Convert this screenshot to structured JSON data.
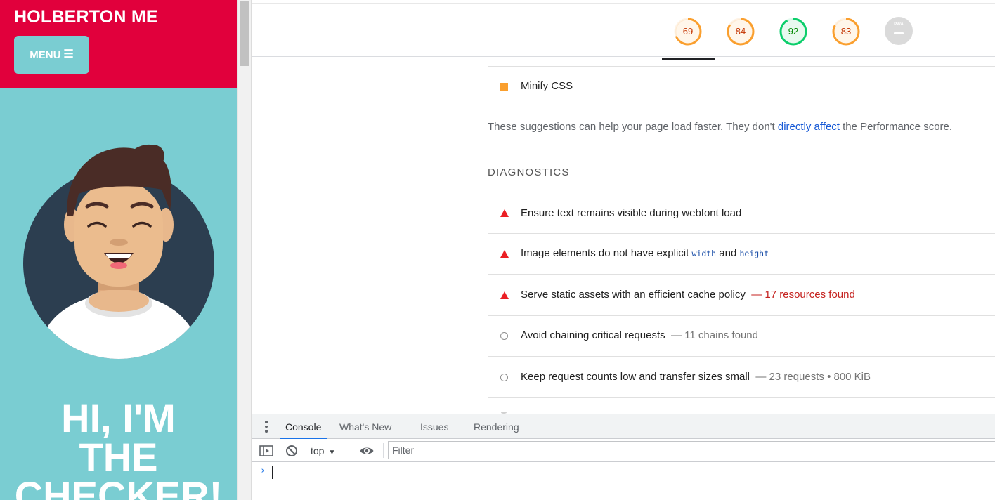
{
  "site": {
    "brand": "HOLBERTON ME",
    "menu_label": "MENU",
    "hero_line1": "HI, I'M",
    "hero_line2": "THE",
    "hero_line3": "CHECKER!",
    "colors": {
      "header": "#e1003c",
      "teal": "#7acdd2"
    }
  },
  "lighthouse": {
    "scores": [
      {
        "value": "69",
        "fraction": 0.69,
        "color": "#fa9f2e",
        "text_color": "#c33300",
        "fill": "#fff6ea"
      },
      {
        "value": "84",
        "fraction": 0.84,
        "color": "#fa9f2e",
        "text_color": "#c33300",
        "fill": "#fff6ea"
      },
      {
        "value": "92",
        "fraction": 0.92,
        "color": "#0cce6b",
        "text_color": "#008800",
        "fill": "#e8f9ef"
      },
      {
        "value": "83",
        "fraction": 0.83,
        "color": "#fa9f2e",
        "text_color": "#c33300",
        "fill": "#fff6ea"
      }
    ],
    "pwa_label": "PWA",
    "opportunity_last": "Minify CSS",
    "suggestion": {
      "before": "These suggestions can help your page load faster. They don't ",
      "link": "directly affect",
      "after": " the Performance score."
    },
    "diagnostics_title": "DIAGNOSTICS",
    "diagnostics": [
      {
        "title": "Ensure text remains visible during webfont load"
      },
      {
        "title_a": "Image elements do not have explicit ",
        "code_a": "width",
        "mid": " and ",
        "code_b": "height"
      },
      {
        "title": "Serve static assets with an efficient cache policy",
        "detail": "— 17 resources found"
      },
      {
        "title": "Avoid chaining critical requests",
        "detail": "— 11 chains found"
      },
      {
        "title": "Keep request counts low and transfer sizes small",
        "detail": "— 23 requests • 800 KiB"
      }
    ]
  },
  "drawer": {
    "tabs": [
      "Console",
      "What's New",
      "Issues",
      "Rendering"
    ],
    "active_tab": "Console",
    "context": "top",
    "filter_placeholder": "Filter",
    "prompt": "›"
  }
}
